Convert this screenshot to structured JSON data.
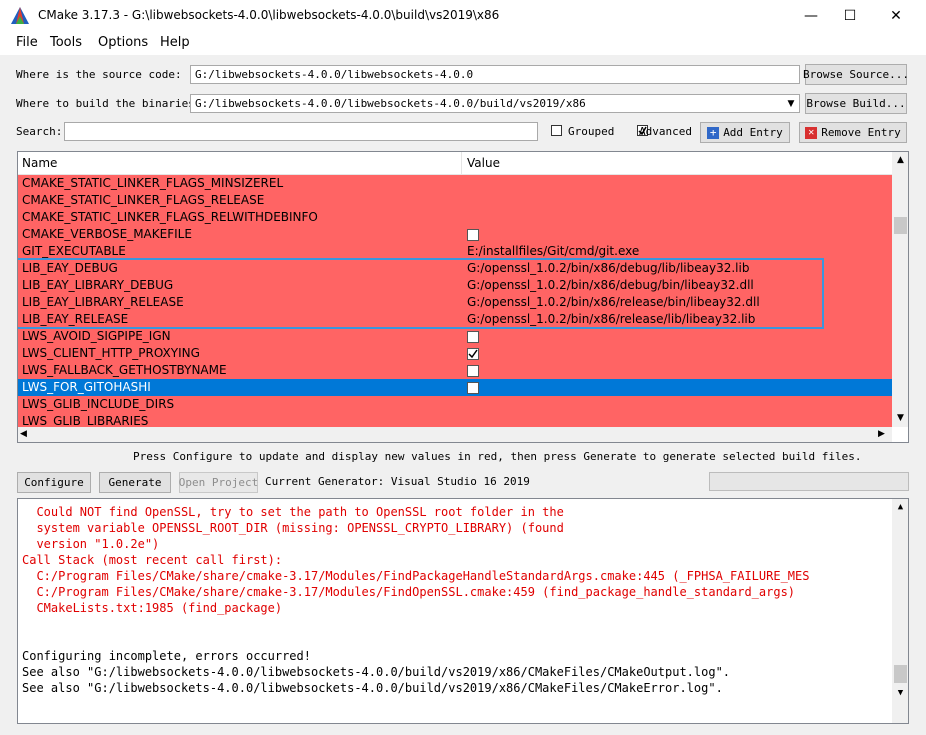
{
  "window": {
    "title": "CMake 3.17.3 - G:\\libwebsockets-4.0.0\\libwebsockets-4.0.0\\build\\vs2019\\x86",
    "icon": "cmake-triangle-icon"
  },
  "menu": [
    "File",
    "Tools",
    "Options",
    "Help"
  ],
  "source": {
    "label": "Where is the source code:",
    "value": "G:/libwebsockets-4.0.0/libwebsockets-4.0.0",
    "browse": "Browse Source..."
  },
  "build": {
    "label": "Where to build the binaries:",
    "value": "G:/libwebsockets-4.0.0/libwebsockets-4.0.0/build/vs2019/x86",
    "browse": "Browse Build..."
  },
  "search": {
    "label": "Search:",
    "value": "",
    "grouped_label": "Grouped",
    "grouped_checked": false,
    "advanced_label": "Advanced",
    "advanced_checked": true,
    "add_entry": "Add Entry",
    "remove_entry": "Remove Entry"
  },
  "table": {
    "headers": {
      "name": "Name",
      "value": "Value"
    },
    "rows": [
      {
        "name": "CMAKE_STATIC_LINKER_FLAGS_MINSIZEREL",
        "value": ""
      },
      {
        "name": "CMAKE_STATIC_LINKER_FLAGS_RELEASE",
        "value": ""
      },
      {
        "name": "CMAKE_STATIC_LINKER_FLAGS_RELWITHDEBINFO",
        "value": ""
      },
      {
        "name": "CMAKE_VERBOSE_MAKEFILE",
        "value": "",
        "checkbox": true,
        "checked": false
      },
      {
        "name": "GIT_EXECUTABLE",
        "value": "E:/installfiles/Git/cmd/git.exe"
      },
      {
        "name": "LIB_EAY_DEBUG",
        "value": "G:/openssl_1.0.2/bin/x86/debug/lib/libeay32.lib"
      },
      {
        "name": "LIB_EAY_LIBRARY_DEBUG",
        "value": "G:/openssl_1.0.2/bin/x86/debug/bin/libeay32.dll"
      },
      {
        "name": "LIB_EAY_LIBRARY_RELEASE",
        "value": "G:/openssl_1.0.2/bin/x86/release/bin/libeay32.dll"
      },
      {
        "name": "LIB_EAY_RELEASE",
        "value": "G:/openssl_1.0.2/bin/x86/release/lib/libeay32.lib"
      },
      {
        "name": "LWS_AVOID_SIGPIPE_IGN",
        "value": "",
        "checkbox": true,
        "checked": false
      },
      {
        "name": "LWS_CLIENT_HTTP_PROXYING",
        "value": "",
        "checkbox": true,
        "checked": true
      },
      {
        "name": "LWS_FALLBACK_GETHOSTBYNAME",
        "value": "",
        "checkbox": true,
        "checked": false
      },
      {
        "name": "LWS_FOR_GITOHASHI",
        "value": "",
        "checkbox": true,
        "checked": false,
        "selected": true
      },
      {
        "name": "LWS_GLIB_INCLUDE_DIRS",
        "value": ""
      },
      {
        "name": "LWS_GLIB_LIBRARIES",
        "value": ""
      }
    ]
  },
  "hint": "Press Configure to update and display new values in red, then press Generate to generate selected build files.",
  "actions": {
    "configure": "Configure",
    "generate": "Generate",
    "open_project": "Open Project",
    "generator": "Current Generator: Visual Studio 16 2019"
  },
  "log": [
    {
      "text": "  Could NOT find OpenSSL, try to set the path to OpenSSL root folder in the",
      "red": true
    },
    {
      "text": "  system variable OPENSSL_ROOT_DIR (missing: OPENSSL_CRYPTO_LIBRARY) (found",
      "red": true
    },
    {
      "text": "  version \"1.0.2e\")",
      "red": true
    },
    {
      "text": "Call Stack (most recent call first):",
      "red": true
    },
    {
      "text": "  C:/Program Files/CMake/share/cmake-3.17/Modules/FindPackageHandleStandardArgs.cmake:445 (_FPHSA_FAILURE_MES",
      "red": true
    },
    {
      "text": "  C:/Program Files/CMake/share/cmake-3.17/Modules/FindOpenSSL.cmake:459 (find_package_handle_standard_args)",
      "red": true
    },
    {
      "text": "  CMakeLists.txt:1985 (find_package)",
      "red": true
    },
    {
      "text": "",
      "red": false
    },
    {
      "text": "",
      "red": false
    },
    {
      "text": "Configuring incomplete, errors occurred!",
      "red": false
    },
    {
      "text": "See also \"G:/libwebsockets-4.0.0/libwebsockets-4.0.0/build/vs2019/x86/CMakeFiles/CMakeOutput.log\".",
      "red": false
    },
    {
      "text": "See also \"G:/libwebsockets-4.0.0/libwebsockets-4.0.0/build/vs2019/x86/CMakeFiles/CMakeError.log\".",
      "red": false
    }
  ],
  "colors": {
    "changed_row": "#ff6464",
    "selected_row": "#0078d7",
    "highlight_box": "#3a96dd",
    "error_text": "#e00000"
  }
}
